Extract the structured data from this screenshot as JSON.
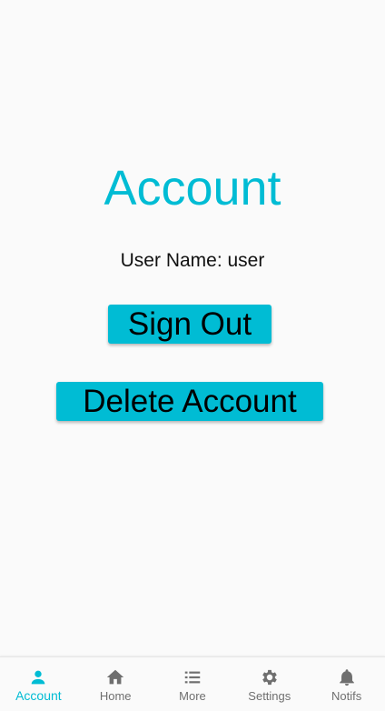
{
  "page": {
    "title": "Account",
    "user_name_text": "User Name: user"
  },
  "actions": {
    "sign_out_label": "Sign Out",
    "delete_account_label": "Delete Account"
  },
  "tabbar": {
    "active": "Account",
    "tabs": [
      {
        "label": "Account",
        "icon": "person-icon"
      },
      {
        "label": "Home",
        "icon": "home-icon"
      },
      {
        "label": "More",
        "icon": "list-icon"
      },
      {
        "label": "Settings",
        "icon": "gear-icon"
      },
      {
        "label": "Notifs",
        "icon": "bell-icon"
      }
    ]
  },
  "colors": {
    "accent": "#00bcd4",
    "background": "#fafafa",
    "inactive_tab": "#6f6f6f"
  }
}
